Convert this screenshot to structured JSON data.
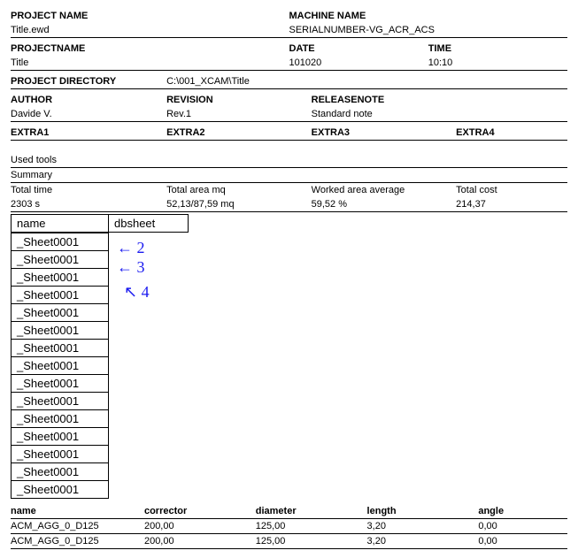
{
  "header": {
    "projectNameLabel": "PROJECT NAME",
    "projectNameValue": "Title.ewd",
    "machineNameLabel": "MACHINE NAME",
    "machineNameValue": "SERIALNUMBER-VG_ACR_ACS",
    "projectNameLabel2": "PROJECTNAME",
    "projectNameValue2": "Title",
    "dateLabel": "DATE",
    "dateValue": "101020",
    "timeLabel": "TIME",
    "timeValue": "10:10",
    "projectDirLabel": "PROJECT DIRECTORY",
    "projectDirValue": "C:\\001_XCAM\\Title",
    "authorLabel": "AUTHOR",
    "authorValue": "Davide V.",
    "revisionLabel": "REVISION",
    "revisionValue": "Rev.1",
    "releaseNoteLabel": "RELEASENOTE",
    "releaseNoteValue": "Standard note",
    "extra1": "EXTRA1",
    "extra2": "EXTRA2",
    "extra3": "EXTRA3",
    "extra4": "EXTRA4"
  },
  "summary": {
    "usedToolsLabel": "Used tools",
    "summaryLabel": "Summary",
    "totalTimeLabel": "Total time",
    "totalTimeValue": "2303 s",
    "totalAreaLabel": "Total area mq",
    "totalAreaValue": "52,13/87,59 mq",
    "workedAreaLabel": "Worked area average",
    "workedAreaValue": "59,52 %",
    "totalCostLabel": "Total cost",
    "totalCostValue": "214,37"
  },
  "sheetTable": {
    "nameHeader": "name",
    "dbHeader": "dbsheet",
    "rows": [
      "_Sheet0001",
      "_Sheet0001",
      "_Sheet0001",
      "_Sheet0001",
      "_Sheet0001",
      "_Sheet0001",
      "_Sheet0001",
      "_Sheet0001",
      "_Sheet0001",
      "_Sheet0001",
      "_Sheet0001",
      "_Sheet0001",
      "_Sheet0001",
      "_Sheet0001",
      "_Sheet0001"
    ]
  },
  "annotations": {
    "a1": "← 2",
    "a2": "← 3",
    "a3": "↖  4"
  },
  "tools": {
    "headers": {
      "name": "name",
      "corrector": "corrector",
      "diameter": "diameter",
      "length": "length",
      "angle": "angle"
    },
    "rows": [
      {
        "name": "ACM_AGG_0_D125",
        "corrector": "200,00",
        "diameter": "125,00",
        "length": "3,20",
        "angle": "0,00"
      },
      {
        "name": "ACM_AGG_0_D125",
        "corrector": "200,00",
        "diameter": "125,00",
        "length": "3,20",
        "angle": "0,00"
      }
    ]
  }
}
